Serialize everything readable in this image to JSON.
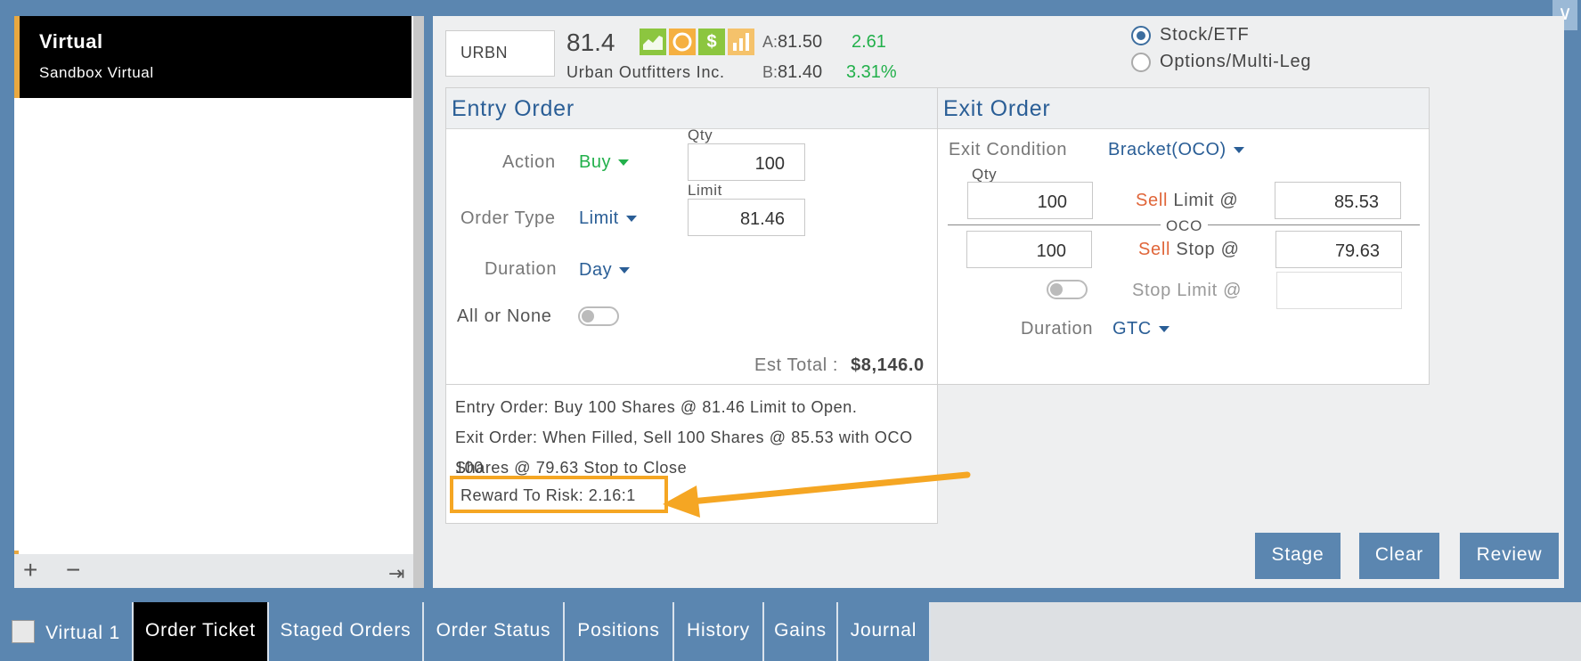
{
  "sidebar": {
    "account_name": "Virtual",
    "account_sub": "Sandbox Virtual",
    "add_icon": "plus-icon",
    "remove_icon": "minus-icon",
    "logout_icon": "sign-out-icon"
  },
  "quote": {
    "symbol": "URBN",
    "price": "81.4",
    "company": "Urban Outfitters Inc.",
    "ask_label": "A:",
    "ask": "81.50",
    "bid_label": "B:",
    "bid": "81.40",
    "change": "2.61",
    "change_pct": "3.31%",
    "badges": [
      {
        "icon": "chart-area-icon",
        "color": "#8cc63f"
      },
      {
        "icon": "circle-icon",
        "color": "#f5b041"
      },
      {
        "icon": "dollar-icon",
        "color": "#8cc63f"
      },
      {
        "icon": "bar-chart-icon",
        "color": "#f5c26b"
      }
    ]
  },
  "instrument": {
    "option1": "Stock/ETF",
    "option2": "Options/Multi-Leg",
    "selected": "Stock/ETF"
  },
  "entry": {
    "title": "Entry Order",
    "action_label": "Action",
    "action_value": "Buy",
    "qty_label": "Qty",
    "qty_value": "100",
    "order_type_label": "Order Type",
    "order_type_value": "Limit",
    "limit_label": "Limit",
    "limit_value": "81.46",
    "duration_label": "Duration",
    "duration_value": "Day",
    "aon_label": "All or None",
    "est_total_label": "Est Total :",
    "est_total_value": "$8,146.0"
  },
  "exit": {
    "title": "Exit Order",
    "condition_label": "Exit Condition",
    "condition_value": "Bracket(OCO)",
    "qty_label": "Qty",
    "limit_qty": "100",
    "limit_sell": "Sell",
    "limit_label": "Limit @",
    "limit_value": "85.53",
    "oco_label": "OCO",
    "stop_qty": "100",
    "stop_sell": "Sell",
    "stop_label": "Stop @",
    "stop_value": "79.63",
    "stop_limit_label": "Stop Limit @",
    "stop_limit_value": "",
    "duration_label": "Duration",
    "duration_value": "GTC"
  },
  "summary": {
    "line1": "Entry Order:  Buy  100 Shares @ 81.46 Limit to Open.",
    "line2": "Exit Order: When Filled, Sell 100 Shares @ 85.53 with OCO 100",
    "line3": "Shares @ 79.63 Stop to Close",
    "reward_risk": "Reward To Risk: 2.16:1"
  },
  "buttons": {
    "stage": "Stage",
    "clear": "Clear",
    "review": "Review"
  },
  "tabs": [
    {
      "label": "Virtual 1"
    },
    {
      "label": "Order Ticket"
    },
    {
      "label": "Staged Orders"
    },
    {
      "label": "Order Status"
    },
    {
      "label": "Positions"
    },
    {
      "label": "History"
    },
    {
      "label": "Gains"
    },
    {
      "label": "Journal"
    }
  ],
  "colors": {
    "accent_blue": "#5b86b0",
    "header_blue": "#2a5e96",
    "gain_green": "#22b04b",
    "sell_orange": "#e0663a",
    "highlight_orange": "#f5a623"
  }
}
